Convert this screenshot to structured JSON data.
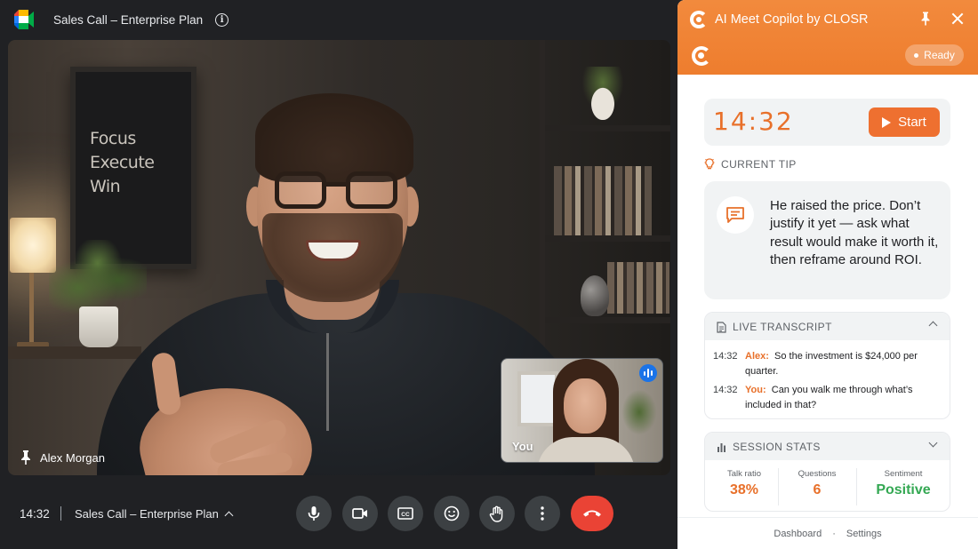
{
  "meeting": {
    "title": "Sales Call – Enterprise Plan",
    "time": "14:32",
    "main_participant": "Alex Morgan",
    "self_label": "You",
    "poster_lines": [
      "Focus",
      "Execute",
      "Win"
    ]
  },
  "controls": {
    "icons": [
      "mic-icon",
      "camera-icon",
      "captions-icon",
      "emoji-icon",
      "raise-hand-icon",
      "more-options-icon",
      "end-call-icon"
    ]
  },
  "copilot": {
    "title": "AI Meet Copilot by CLOSR",
    "status": "Ready",
    "timer": "14:32",
    "start_label": "Start",
    "current_tip_label": "CURRENT TIP",
    "tip_text": "He raised the price. Don’t justify it yet — ask what result would make it worth it, then reframe around ROI.",
    "transcript_label": "LIVE TRANSCRIPT",
    "transcript": [
      {
        "time": "14:32",
        "speaker": "Alex:",
        "text": "So the investment is $24,000 per quarter."
      },
      {
        "time": "14:32",
        "speaker": "You:",
        "text": "Can you walk me through what’s included in that?"
      }
    ],
    "stats_label": "SESSION STATS",
    "stats": [
      {
        "label": "Talk ratio",
        "value": "38%",
        "color": "#e8702a"
      },
      {
        "label": "Questions",
        "value": "6",
        "color": "#e8702a"
      },
      {
        "label": "Sentiment",
        "value": "Positive",
        "color": "#34a853"
      }
    ],
    "footer_links": [
      "Dashboard",
      "Settings"
    ],
    "footer_sep": "·",
    "accent": "#ee7d2e"
  }
}
